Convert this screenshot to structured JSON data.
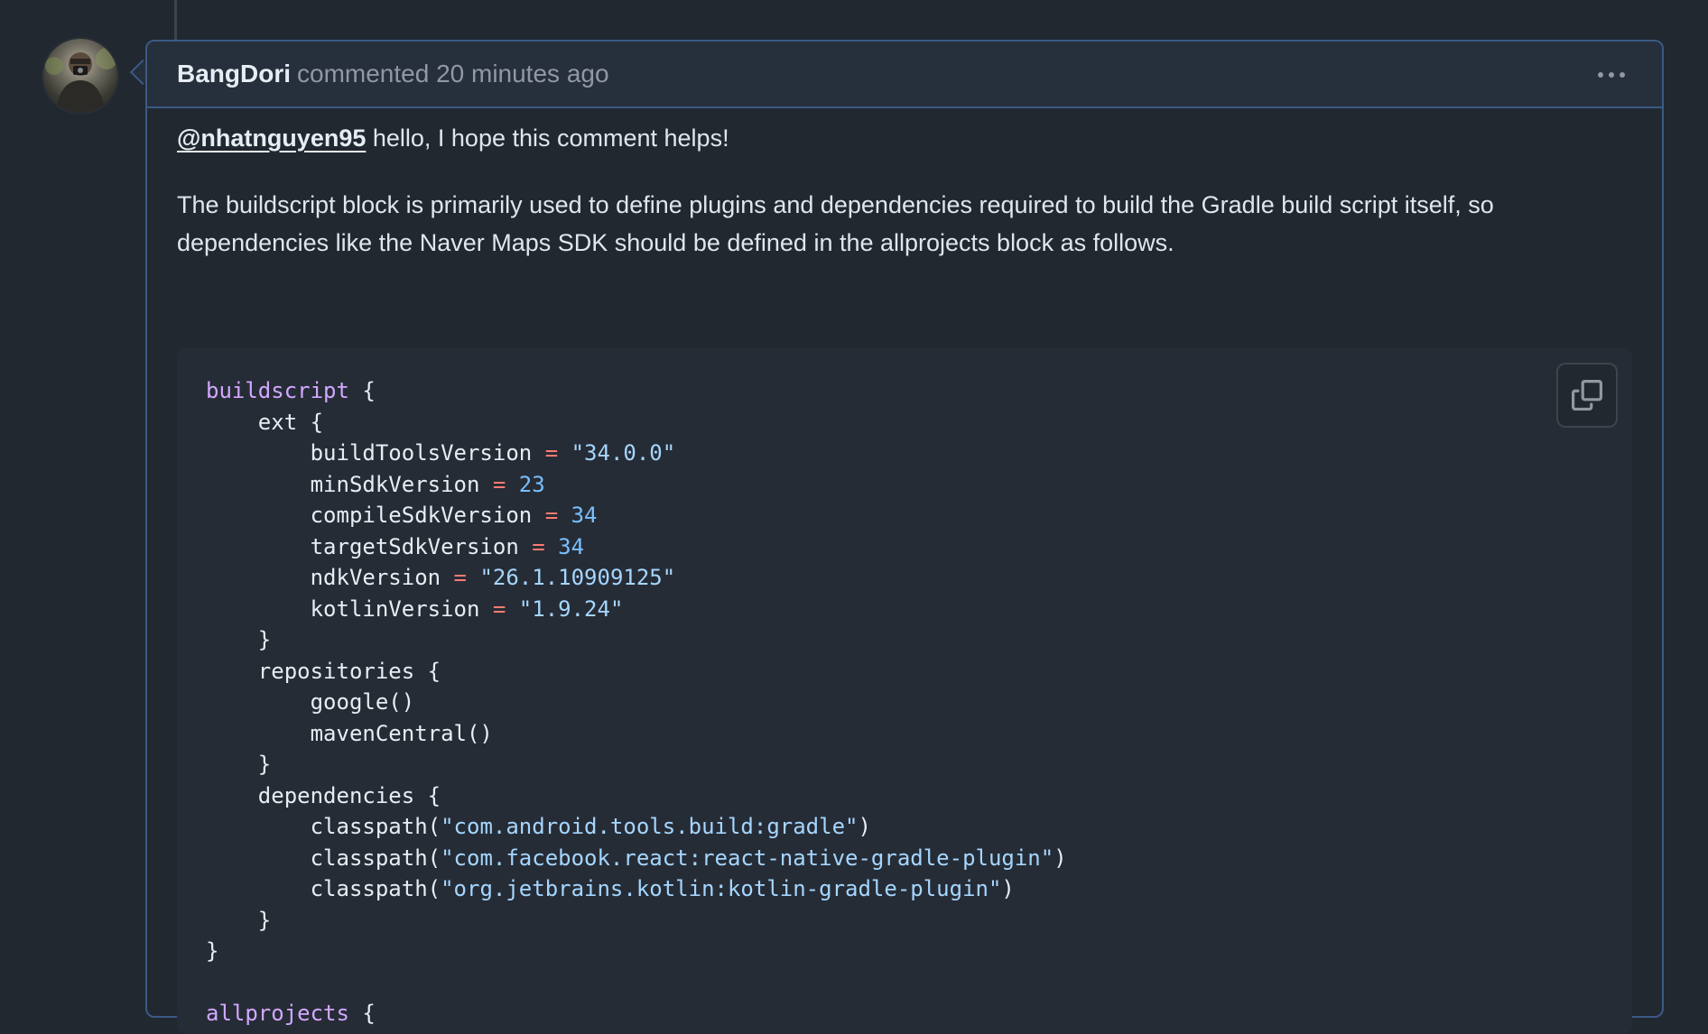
{
  "comment": {
    "author": "BangDori",
    "meta": "commented 20 minutes ago",
    "mention": "@nhatnguyen95",
    "greeting": " hello, I hope this comment helps!",
    "paragraph": "The buildscript block is primarily used to define plugins and dependencies required to build the Gradle build script itself, so dependencies like the Naver Maps SDK should be defined in the allprojects block as follows."
  },
  "code": {
    "buildscript": "buildscript",
    "open_brace": " {",
    "ext": "    ext {",
    "lines": [
      {
        "name": "buildToolsVersion",
        "indent": "        ",
        "op": "=",
        "value": "\"34.0.0\"",
        "type": "str"
      },
      {
        "name": "minSdkVersion",
        "indent": "        ",
        "op": "=",
        "value": "23",
        "type": "num"
      },
      {
        "name": "compileSdkVersion",
        "indent": "        ",
        "op": "=",
        "value": "34",
        "type": "num"
      },
      {
        "name": "targetSdkVersion",
        "indent": "        ",
        "op": "=",
        "value": "34",
        "type": "num"
      },
      {
        "name": "ndkVersion",
        "indent": "        ",
        "op": "=",
        "value": "\"26.1.10909125\"",
        "type": "str"
      },
      {
        "name": "kotlinVersion",
        "indent": "        ",
        "op": "=",
        "value": "\"1.9.24\"",
        "type": "str"
      }
    ],
    "close_inner": "    }",
    "repositories": "    repositories {",
    "google": "        google()",
    "mavenCentral": "        mavenCentral()",
    "dependencies": "    dependencies {",
    "classpath_prefix": "        classpath(",
    "classpaths": [
      "\"com.android.tools.build:gradle\"",
      "\"com.facebook.react:react-native-gradle-plugin\"",
      "\"org.jetbrains.kotlin:kotlin-gradle-plugin\""
    ],
    "classpath_suffix": ")",
    "close_outer": "}",
    "allprojects": "allprojects"
  },
  "icons": {
    "more": "kebab-horizontal-icon",
    "copy": "copy-icon"
  },
  "colors": {
    "background": "#212830",
    "header": "#262f3c",
    "border": "#3b5a85",
    "keyword": "#d2a8ff",
    "operator": "#ff7b72",
    "string": "#a5d6ff",
    "number": "#79c0ff"
  }
}
